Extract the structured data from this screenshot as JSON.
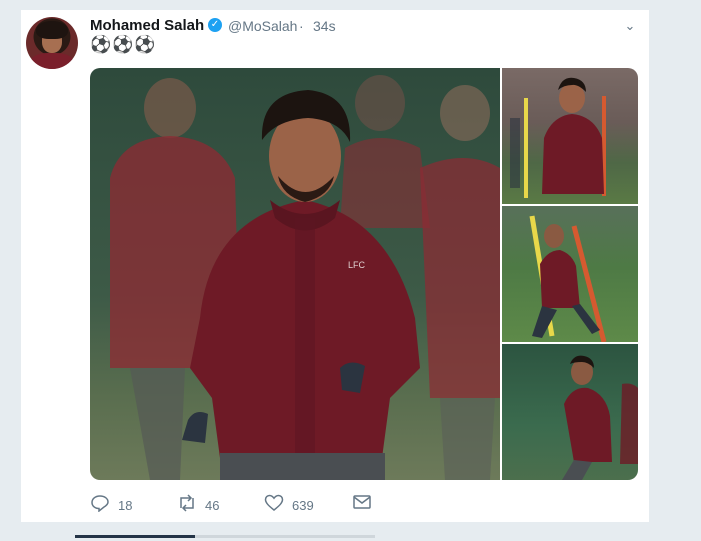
{
  "tweet": {
    "author_name": "Mohamed Salah",
    "verified_icon": "verified-badge-icon",
    "handle": "@MoSalah",
    "separator": "·",
    "time": "34s",
    "text": "⚽⚽⚽",
    "menu_icon": "chevron-down-icon"
  },
  "media": {
    "photos": [
      "main-training-photo",
      "training-photo-2",
      "training-photo-3",
      "training-photo-4"
    ]
  },
  "actions": {
    "reply": {
      "icon": "reply-icon",
      "count": "18"
    },
    "retweet": {
      "icon": "retweet-icon",
      "count": "46"
    },
    "like": {
      "icon": "heart-icon",
      "count": "639"
    },
    "message": {
      "icon": "envelope-icon"
    }
  },
  "colors": {
    "background": "#e6ecf0",
    "card": "#ffffff",
    "verified": "#1da1f2",
    "muted": "#657786",
    "kit": "#7a1f2b"
  }
}
